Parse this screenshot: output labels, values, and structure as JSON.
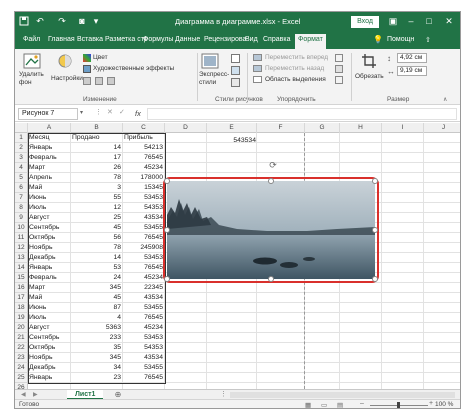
{
  "titlebar": {
    "title": "Диаграмма в диаграмме.xlsx  -  Excel",
    "format_hint": "Ра...",
    "sign_in": "Вход"
  },
  "tabs": [
    {
      "label": "Файл"
    },
    {
      "label": "Главная"
    },
    {
      "label": "Вставка"
    },
    {
      "label": "Разметка стр"
    },
    {
      "label": "Формулы"
    },
    {
      "label": "Данные"
    },
    {
      "label": "Рецензирова"
    },
    {
      "label": "Вид"
    },
    {
      "label": "Справка"
    },
    {
      "label": "Формат"
    }
  ],
  "help_tab": "Помощн",
  "ribbon": {
    "remove_bg": "Удалить\nфон",
    "settings": "Настройки",
    "color": "Цвет",
    "art_effects": "Художественные эффекты",
    "group_change": "Изменение",
    "express_styles": "Экспресс-\nстили",
    "group_styles": "Стили рисунков",
    "forward": "Переместить вперед",
    "backward": "Переместить назад",
    "selection_pane": "Область выделения",
    "group_order": "Упорядочить",
    "crop": "Обрезать",
    "height": "4,92 см",
    "width": "9,19 см",
    "group_size": "Размер"
  },
  "formula_bar": {
    "name_box": "Рисунок 7",
    "fx": "fx"
  },
  "columns": [
    "A",
    "B",
    "C",
    "D",
    "E",
    "F",
    "G",
    "H",
    "I",
    "J"
  ],
  "rows": [
    "1",
    "2",
    "3",
    "4",
    "5",
    "6",
    "7",
    "8",
    "9",
    "10",
    "11",
    "12",
    "13",
    "14",
    "15",
    "16",
    "17",
    "18",
    "19",
    "20",
    "21",
    "22",
    "23",
    "24",
    "25",
    "26"
  ],
  "table": {
    "headers": [
      "Месяц",
      "Продано",
      "Прибыль"
    ],
    "data": [
      [
        "Январь",
        "14",
        "54213"
      ],
      [
        "Февраль",
        "17",
        "76545"
      ],
      [
        "Март",
        "26",
        "45234"
      ],
      [
        "Апрель",
        "78",
        "178000"
      ],
      [
        "Май",
        "3",
        "15345"
      ],
      [
        "Июнь",
        "55",
        "53453"
      ],
      [
        "Июль",
        "12",
        "54353"
      ],
      [
        "Август",
        "25",
        "43534"
      ],
      [
        "Сентябрь",
        "45",
        "53455"
      ],
      [
        "Октябрь",
        "56",
        "76545"
      ],
      [
        "Ноябрь",
        "78",
        "245908"
      ],
      [
        "Декабрь",
        "14",
        "53453"
      ],
      [
        "Январь",
        "53",
        "76545"
      ],
      [
        "Февраль",
        "24",
        "45234"
      ],
      [
        "Март",
        "345",
        "22345"
      ],
      [
        "Май",
        "45",
        "43534"
      ],
      [
        "Июнь",
        "87",
        "53455"
      ],
      [
        "Июль",
        "4",
        "76545"
      ],
      [
        "Август",
        "5363",
        "45234"
      ],
      [
        "Сентябрь",
        "233",
        "53453"
      ],
      [
        "Октябрь",
        "35",
        "54353"
      ],
      [
        "Ноябрь",
        "345",
        "43534"
      ],
      [
        "Декабрь",
        "34",
        "53455"
      ],
      [
        "Январь",
        "23",
        "76545"
      ]
    ]
  },
  "e1_value": "543534",
  "sheet_tab": "Лист1",
  "status": "Готово",
  "zoom": "100 %"
}
